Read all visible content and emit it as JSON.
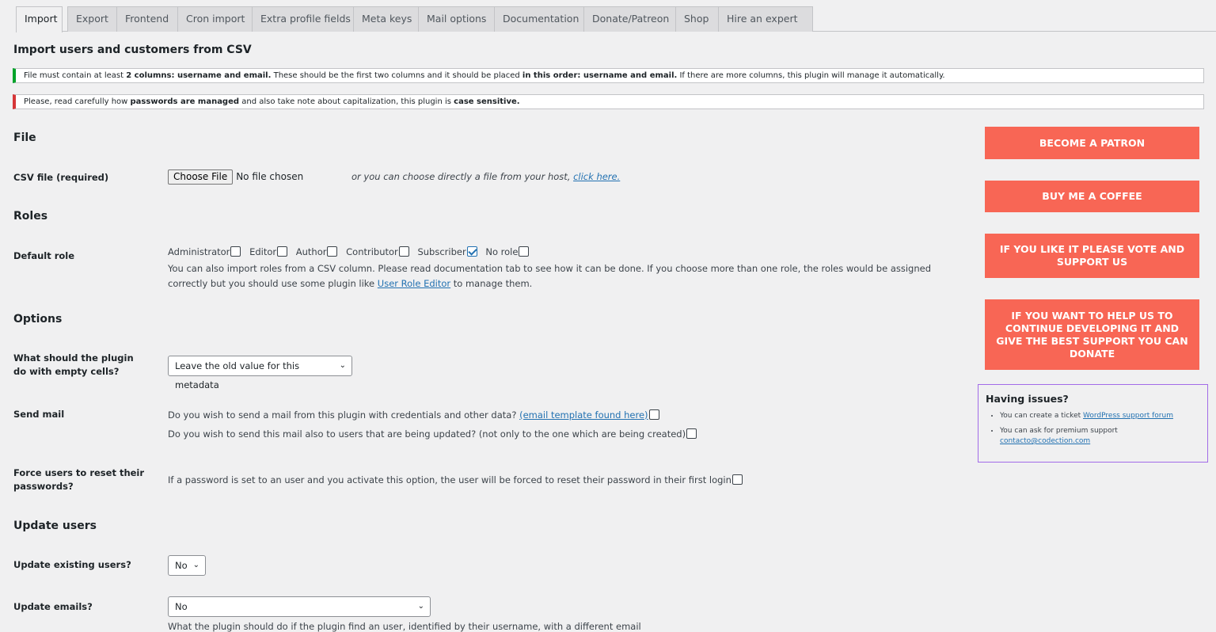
{
  "tabs": [
    "Import",
    "Export",
    "Frontend",
    "Cron import",
    "Extra profile fields",
    "Meta keys",
    "Mail options",
    "Documentation",
    "Donate/Patreon",
    "Shop",
    "Hire an expert"
  ],
  "page_title": "Import users and customers from CSV",
  "notices": {
    "columns": {
      "part1": "File must contain at least ",
      "bold1": "2 columns: username and email.",
      "part2": " These should be the first two columns and it should be placed ",
      "bold2": "in this order: username and email.",
      "part3": " If there are more columns, this plugin will manage it automatically."
    },
    "passwords": {
      "part1": "Please, read carefully how ",
      "bold1": "passwords are managed",
      "part2": " and also take note about capitalization, this plugin is ",
      "bold2": "case sensitive."
    }
  },
  "file_section": {
    "title": "File",
    "csv_label": "CSV file (required)",
    "choose_button": "Choose File",
    "no_file": "No file chosen",
    "host_note": "or you can choose directly a file from your host, ",
    "host_link": "click here."
  },
  "roles_section": {
    "title": "Roles",
    "default_role_label": "Default role",
    "roles": [
      {
        "label": "Administrator",
        "checked": false
      },
      {
        "label": "Editor",
        "checked": false
      },
      {
        "label": "Author",
        "checked": false
      },
      {
        "label": "Contributor",
        "checked": false
      },
      {
        "label": "Subscriber",
        "checked": true
      },
      {
        "label": "No role",
        "checked": false
      }
    ],
    "help_1": "You can also import roles from a CSV column. Please read documentation tab to see how it can be done. If you choose more than one role, the roles would be assigned",
    "help_2a": "correctly but you should use some plugin like ",
    "help_link": "User Role Editor",
    "help_2b": " to manage them."
  },
  "options_section": {
    "title": "Options",
    "empty_cells_label": "What should the plugin do with empty cells?",
    "empty_cells_value": "Leave the old value for this metadata",
    "send_mail_label": "Send mail",
    "send_mail_q1": "Do you wish to send a mail from this plugin with credentials and other data? ",
    "send_mail_link": "(email template found here)",
    "send_mail_q2": "Do you wish to send this mail also to users that are being updated? (not only to the one which are being created)",
    "force_reset_label": "Force users to reset their passwords?",
    "force_reset_text": "If a password is set to an user and you activate this option, the user will be forced to reset their password in their first login"
  },
  "update_section": {
    "title": "Update users",
    "update_existing_label": "Update existing users?",
    "update_existing_value": "No",
    "update_emails_label": "Update emails?",
    "update_emails_value": "No",
    "update_emails_note": "What the plugin should do if the plugin find an user, identified by their username, with a different email"
  },
  "sidebar": {
    "cta_patron": "BECOME A PATRON",
    "cta_coffee": "BUY ME A COFFEE",
    "cta_vote": "IF YOU LIKE IT PLEASE VOTE AND SUPPORT US",
    "cta_donate": "IF YOU WANT TO HELP US TO CONTINUE DEVELOPING IT AND GIVE THE BEST SUPPORT YOU CAN DONATE",
    "issues_title": "Having issues?",
    "issue_1_text": "You can create a ticket ",
    "issue_1_link": "WordPress support forum",
    "issue_2_text": "You can ask for premium support",
    "issue_2_link": "contacto@codection.com"
  },
  "colors": {
    "cta": "#f86655",
    "notice_green": "#00a32a",
    "notice_red": "#d63638",
    "link": "#2271b1"
  }
}
